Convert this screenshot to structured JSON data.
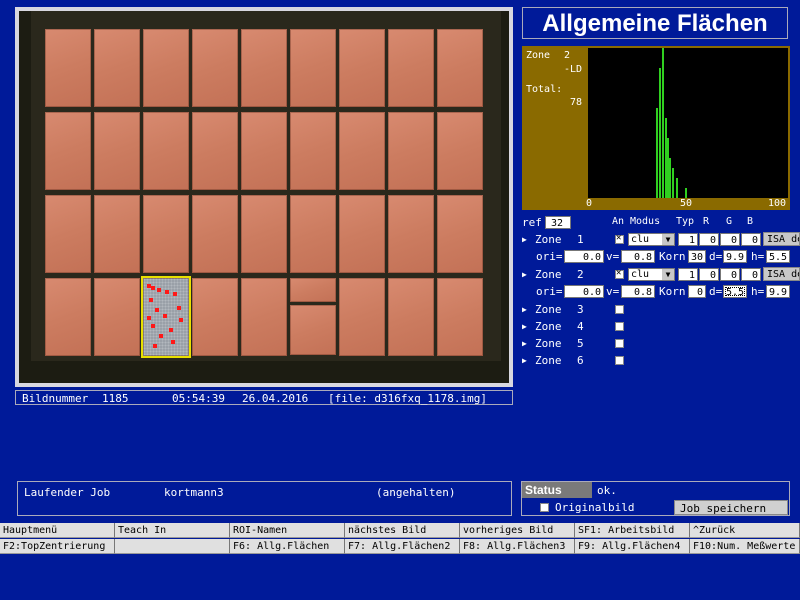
{
  "image_view": {
    "rows": 4,
    "cols": 9,
    "defect_tile": {
      "row": 3,
      "col": 2
    }
  },
  "info_bar": {
    "bildnummer_label": "Bildnummer",
    "bildnummer": "1185",
    "time": "05:54:39",
    "date": "26.04.2016",
    "file": "[file: d316fxq_1178.img]"
  },
  "title": "Allgemeine Flächen",
  "histogram": {
    "zone_label": "Zone",
    "zone_number": "2",
    "suffix": "-LD",
    "total_label": "Total:",
    "total_value": "78",
    "x_ticks": [
      "0",
      "50",
      "100"
    ],
    "colors": {
      "background": "#8a6a00",
      "plot": "#000000",
      "bars": "#30d020"
    }
  },
  "zones_panel": {
    "ref_label": "ref",
    "ref_value": "32",
    "headers": {
      "an": "An",
      "modus": "Modus",
      "typ": "Typ",
      "r": "R",
      "g": "G",
      "b": "B"
    },
    "zones": [
      {
        "label": "Zone",
        "num": "1",
        "checked": true,
        "modus": "clu",
        "typ": "1",
        "r": "0",
        "g": "0",
        "b": "0",
        "isa": "ISA de",
        "ori_label": "ori=",
        "ori": "0.0",
        "v_label": "v=",
        "v": "0.8",
        "korn_label": "Korn",
        "korn": "30",
        "d_label": "d=",
        "d": "9.9",
        "h_label": "h=",
        "h": "5.5"
      },
      {
        "label": "Zone",
        "num": "2",
        "checked": true,
        "modus": "clu",
        "typ": "1",
        "r": "0",
        "g": "0",
        "b": "0",
        "isa": "ISA de",
        "ori_label": "ori=",
        "ori": "0.0",
        "v_label": "v=",
        "v": "0.8",
        "korn_label": "Korn",
        "korn": "0",
        "d_label": "d=",
        "d": "5.5",
        "h_label": "h=",
        "h": "9.9"
      },
      {
        "label": "Zone",
        "num": "3",
        "checked": false
      },
      {
        "label": "Zone",
        "num": "4",
        "checked": false
      },
      {
        "label": "Zone",
        "num": "5",
        "checked": false
      },
      {
        "label": "Zone",
        "num": "6",
        "checked": false
      }
    ]
  },
  "job_bar": {
    "label": "Laufender Job",
    "name": "kortmann3",
    "state": "(angehalten)"
  },
  "status": {
    "label": "Status",
    "value": "ok.",
    "originalbild": "Originalbild",
    "save_button": "Job speichern"
  },
  "function_keys": {
    "row1": [
      "Hauptmenü",
      "Teach In",
      "ROI-Namen",
      "nächstes Bild",
      "vorheriges Bild",
      "SF1: Arbeitsbild",
      "^Zurück"
    ],
    "row2": [
      "F2:TopZentrierung",
      "",
      "F6: Allg.Flächen",
      "F7: Allg.Flächen2",
      "F8: Allg.Flächen3",
      "F9: Allg.Flächen4",
      "F10:Num. Meßwerte"
    ]
  }
}
